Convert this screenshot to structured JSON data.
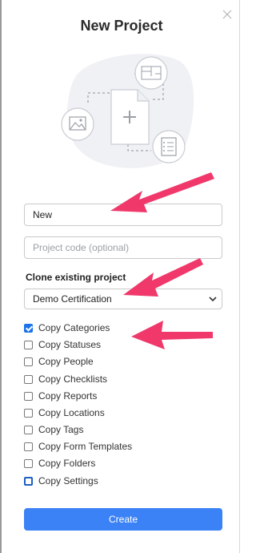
{
  "dialog": {
    "title": "New Project",
    "name_value": "New",
    "code_placeholder": "Project code (optional)",
    "clone_label": "Clone existing project",
    "clone_selected": "Demo Certification",
    "create_label": "Create"
  },
  "options": [
    {
      "label": "Copy Categories",
      "checked": true
    },
    {
      "label": "Copy Statuses",
      "checked": false
    },
    {
      "label": "Copy People",
      "checked": false
    },
    {
      "label": "Copy Checklists",
      "checked": false
    },
    {
      "label": "Copy Reports",
      "checked": false
    },
    {
      "label": "Copy Locations",
      "checked": false
    },
    {
      "label": "Copy Tags",
      "checked": false
    },
    {
      "label": "Copy Form Templates",
      "checked": false
    },
    {
      "label": "Copy Folders",
      "checked": false
    },
    {
      "label": "Copy Settings",
      "checked": false
    }
  ],
  "colors": {
    "accent": "#3b82f6",
    "annotation_arrow": "#f0386b"
  },
  "icons": [
    "close-icon",
    "chevron-down-icon",
    "image-icon",
    "plus-icon",
    "checklist-icon",
    "blueprint-icon"
  ]
}
